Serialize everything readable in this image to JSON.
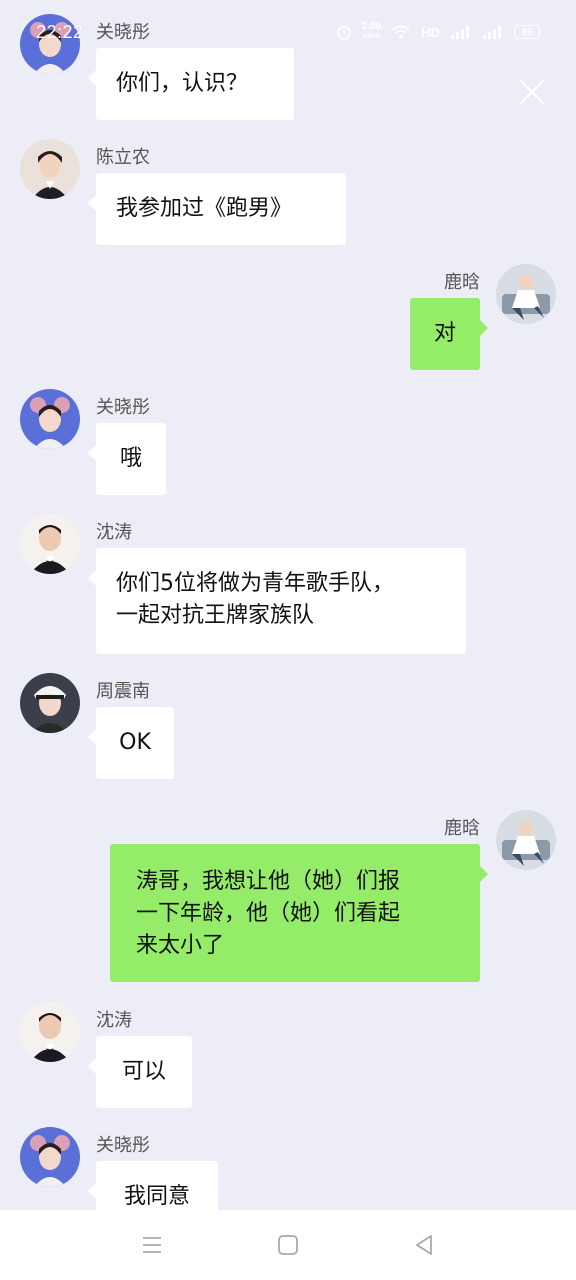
{
  "status_bar": {
    "time": "22:22",
    "network_speed_top": "2.00",
    "network_speed_unit": "KB/S",
    "hd_label": "HD",
    "battery": "65"
  },
  "messages": [
    {
      "sender": "关晓彤",
      "text": "你们，认识？",
      "side": "left",
      "avatar": "guanxiaotong-avatar"
    },
    {
      "sender": "陈立农",
      "text": "我参加过《跑男》",
      "side": "left",
      "avatar": "chenlinong-avatar"
    },
    {
      "sender": "鹿晗",
      "text": "对",
      "side": "right",
      "avatar": "luhan-avatar"
    },
    {
      "sender": "关晓彤",
      "text": "哦",
      "side": "left",
      "avatar": "guanxiaotong-avatar"
    },
    {
      "sender": "沈涛",
      "text_lines": [
        "你们5位将做为青年歌手队，",
        "一起对抗王牌家族队"
      ],
      "side": "left",
      "avatar": "shentao-avatar"
    },
    {
      "sender": "周震南",
      "text": "OK",
      "side": "left",
      "avatar": "zhouzhennan-avatar"
    },
    {
      "sender": "鹿晗",
      "text_lines": [
        "涛哥，我想让他（她）们报",
        "一下年龄，他（她）们看起",
        "来太小了"
      ],
      "side": "right",
      "avatar": "luhan-avatar"
    },
    {
      "sender": "沈涛",
      "text": "可以",
      "side": "left",
      "avatar": "shentao-avatar"
    },
    {
      "sender": "关晓彤",
      "text": "我同意",
      "side": "left",
      "avatar": "guanxiaotong-avatar"
    }
  ],
  "colors": {
    "background": "#ededf7",
    "self_bubble": "#95ec69",
    "other_bubble": "#ffffff"
  }
}
